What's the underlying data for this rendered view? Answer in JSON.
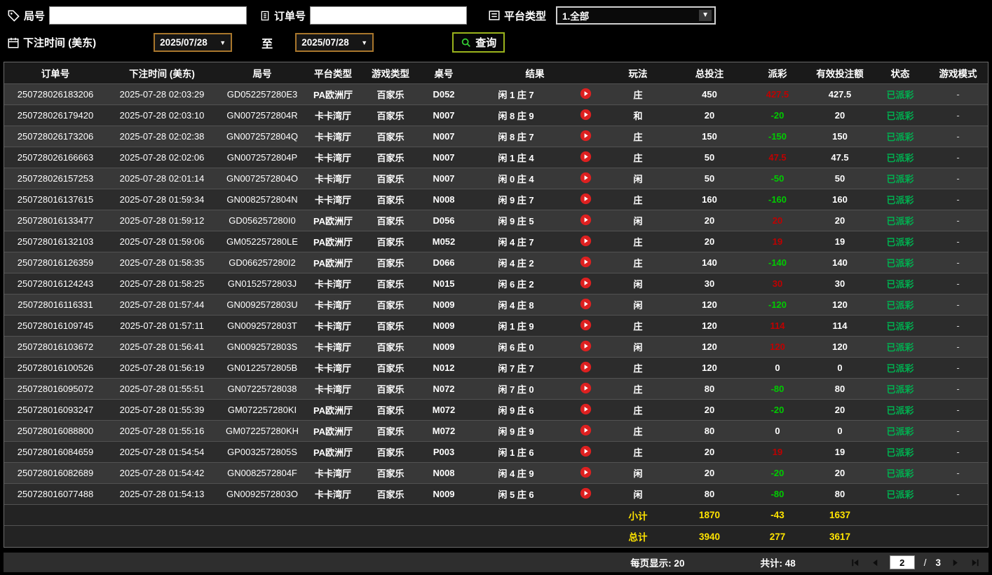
{
  "filters": {
    "round": {
      "label": "局号",
      "value": ""
    },
    "order": {
      "label": "订单号",
      "value": ""
    },
    "platform": {
      "label": "平台类型",
      "value": "1.全部"
    },
    "bet_time": {
      "label": "下注时间 (美东)",
      "from": "2025/07/28",
      "to_label": "至",
      "to": "2025/07/28"
    },
    "query_label": "查询"
  },
  "table": {
    "headers": [
      "订单号",
      "下注时间 (美东)",
      "局号",
      "平台类型",
      "游戏类型",
      "桌号",
      "结果",
      "玩法",
      "总投注",
      "派彩",
      "有效投注额",
      "状态",
      "游戏模式"
    ],
    "rows": [
      {
        "id": "250728026183206",
        "time": "2025-07-28 02:03:29",
        "round": "GD052257280E3",
        "platform": "PA欧洲厅",
        "game": "百家乐",
        "table": "D052",
        "result": "闲 1 庄 7",
        "play": "庄",
        "bet": "450",
        "payout": "427.5",
        "valid": "427.5",
        "status": "已派彩",
        "mode": "-"
      },
      {
        "id": "250728026179420",
        "time": "2025-07-28 02:03:10",
        "round": "GN0072572804R",
        "platform": "卡卡湾厅",
        "game": "百家乐",
        "table": "N007",
        "result": "闲 8 庄 9",
        "play": "和",
        "bet": "20",
        "payout": "-20",
        "valid": "20",
        "status": "已派彩",
        "mode": "-"
      },
      {
        "id": "250728026173206",
        "time": "2025-07-28 02:02:38",
        "round": "GN0072572804Q",
        "platform": "卡卡湾厅",
        "game": "百家乐",
        "table": "N007",
        "result": "闲 8 庄 7",
        "play": "庄",
        "bet": "150",
        "payout": "-150",
        "valid": "150",
        "status": "已派彩",
        "mode": "-"
      },
      {
        "id": "250728026166663",
        "time": "2025-07-28 02:02:06",
        "round": "GN0072572804P",
        "platform": "卡卡湾厅",
        "game": "百家乐",
        "table": "N007",
        "result": "闲 1 庄 4",
        "play": "庄",
        "bet": "50",
        "payout": "47.5",
        "valid": "47.5",
        "status": "已派彩",
        "mode": "-"
      },
      {
        "id": "250728026157253",
        "time": "2025-07-28 02:01:14",
        "round": "GN0072572804O",
        "platform": "卡卡湾厅",
        "game": "百家乐",
        "table": "N007",
        "result": "闲 0 庄 4",
        "play": "闲",
        "bet": "50",
        "payout": "-50",
        "valid": "50",
        "status": "已派彩",
        "mode": "-"
      },
      {
        "id": "250728016137615",
        "time": "2025-07-28 01:59:34",
        "round": "GN0082572804N",
        "platform": "卡卡湾厅",
        "game": "百家乐",
        "table": "N008",
        "result": "闲 9 庄 7",
        "play": "庄",
        "bet": "160",
        "payout": "-160",
        "valid": "160",
        "status": "已派彩",
        "mode": "-"
      },
      {
        "id": "250728016133477",
        "time": "2025-07-28 01:59:12",
        "round": "GD056257280I0",
        "platform": "PA欧洲厅",
        "game": "百家乐",
        "table": "D056",
        "result": "闲 9 庄 5",
        "play": "闲",
        "bet": "20",
        "payout": "20",
        "valid": "20",
        "status": "已派彩",
        "mode": "-"
      },
      {
        "id": "250728016132103",
        "time": "2025-07-28 01:59:06",
        "round": "GM052257280LE",
        "platform": "PA欧洲厅",
        "game": "百家乐",
        "table": "M052",
        "result": "闲 4 庄 7",
        "play": "庄",
        "bet": "20",
        "payout": "19",
        "valid": "19",
        "status": "已派彩",
        "mode": "-"
      },
      {
        "id": "250728016126359",
        "time": "2025-07-28 01:58:35",
        "round": "GD066257280I2",
        "platform": "PA欧洲厅",
        "game": "百家乐",
        "table": "D066",
        "result": "闲 4 庄 2",
        "play": "庄",
        "bet": "140",
        "payout": "-140",
        "valid": "140",
        "status": "已派彩",
        "mode": "-"
      },
      {
        "id": "250728016124243",
        "time": "2025-07-28 01:58:25",
        "round": "GN0152572803J",
        "platform": "卡卡湾厅",
        "game": "百家乐",
        "table": "N015",
        "result": "闲 6 庄 2",
        "play": "闲",
        "bet": "30",
        "payout": "30",
        "valid": "30",
        "status": "已派彩",
        "mode": "-"
      },
      {
        "id": "250728016116331",
        "time": "2025-07-28 01:57:44",
        "round": "GN0092572803U",
        "platform": "卡卡湾厅",
        "game": "百家乐",
        "table": "N009",
        "result": "闲 4 庄 8",
        "play": "闲",
        "bet": "120",
        "payout": "-120",
        "valid": "120",
        "status": "已派彩",
        "mode": "-"
      },
      {
        "id": "250728016109745",
        "time": "2025-07-28 01:57:11",
        "round": "GN0092572803T",
        "platform": "卡卡湾厅",
        "game": "百家乐",
        "table": "N009",
        "result": "闲 1 庄 9",
        "play": "庄",
        "bet": "120",
        "payout": "114",
        "valid": "114",
        "status": "已派彩",
        "mode": "-"
      },
      {
        "id": "250728016103672",
        "time": "2025-07-28 01:56:41",
        "round": "GN0092572803S",
        "platform": "卡卡湾厅",
        "game": "百家乐",
        "table": "N009",
        "result": "闲 6 庄 0",
        "play": "闲",
        "bet": "120",
        "payout": "120",
        "valid": "120",
        "status": "已派彩",
        "mode": "-"
      },
      {
        "id": "250728016100526",
        "time": "2025-07-28 01:56:19",
        "round": "GN0122572805B",
        "platform": "卡卡湾厅",
        "game": "百家乐",
        "table": "N012",
        "result": "闲 7 庄 7",
        "play": "庄",
        "bet": "120",
        "payout": "0",
        "valid": "0",
        "status": "已派彩",
        "mode": "-"
      },
      {
        "id": "250728016095072",
        "time": "2025-07-28 01:55:51",
        "round": "GN07225728038",
        "platform": "卡卡湾厅",
        "game": "百家乐",
        "table": "N072",
        "result": "闲 7 庄 0",
        "play": "庄",
        "bet": "80",
        "payout": "-80",
        "valid": "80",
        "status": "已派彩",
        "mode": "-"
      },
      {
        "id": "250728016093247",
        "time": "2025-07-28 01:55:39",
        "round": "GM072257280KI",
        "platform": "PA欧洲厅",
        "game": "百家乐",
        "table": "M072",
        "result": "闲 9 庄 6",
        "play": "庄",
        "bet": "20",
        "payout": "-20",
        "valid": "20",
        "status": "已派彩",
        "mode": "-"
      },
      {
        "id": "250728016088800",
        "time": "2025-07-28 01:55:16",
        "round": "GM072257280KH",
        "platform": "PA欧洲厅",
        "game": "百家乐",
        "table": "M072",
        "result": "闲 9 庄 9",
        "play": "庄",
        "bet": "80",
        "payout": "0",
        "valid": "0",
        "status": "已派彩",
        "mode": "-"
      },
      {
        "id": "250728016084659",
        "time": "2025-07-28 01:54:54",
        "round": "GP0032572805S",
        "platform": "PA欧洲厅",
        "game": "百家乐",
        "table": "P003",
        "result": "闲 1 庄 6",
        "play": "庄",
        "bet": "20",
        "payout": "19",
        "valid": "19",
        "status": "已派彩",
        "mode": "-"
      },
      {
        "id": "250728016082689",
        "time": "2025-07-28 01:54:42",
        "round": "GN0082572804F",
        "platform": "卡卡湾厅",
        "game": "百家乐",
        "table": "N008",
        "result": "闲 4 庄 9",
        "play": "闲",
        "bet": "20",
        "payout": "-20",
        "valid": "20",
        "status": "已派彩",
        "mode": "-"
      },
      {
        "id": "250728016077488",
        "time": "2025-07-28 01:54:13",
        "round": "GN0092572803O",
        "platform": "卡卡湾厅",
        "game": "百家乐",
        "table": "N009",
        "result": "闲 5 庄 6",
        "play": "闲",
        "bet": "80",
        "payout": "-80",
        "valid": "80",
        "status": "已派彩",
        "mode": "-"
      }
    ]
  },
  "summary": {
    "subtotal_label": "小计",
    "subtotal": {
      "bet": "1870",
      "payout": "-43",
      "valid": "1637"
    },
    "total_label": "总计",
    "total": {
      "bet": "3940",
      "payout": "277",
      "valid": "3617"
    }
  },
  "pagination": {
    "per_page_text": "每页显示: 20",
    "total_text": "共计: 48",
    "current_page": "2",
    "slash": "/",
    "total_pages": "3"
  },
  "colors": {
    "payout_positive": "#c00000",
    "payout_negative": "#00cc00",
    "status_paid": "#00b050",
    "summary_yellow": "#ffe400",
    "query_border": "#9ab31c",
    "date_border": "#a8762c"
  }
}
